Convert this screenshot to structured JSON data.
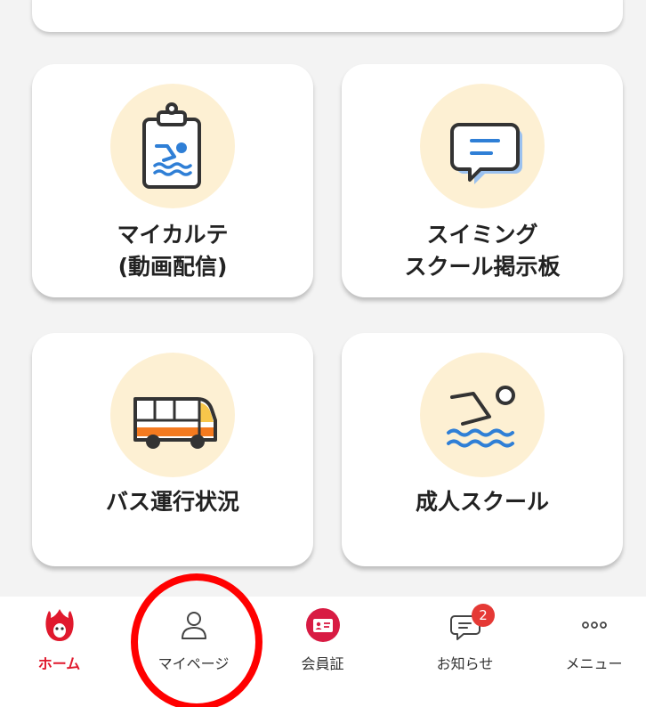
{
  "tiles": [
    {
      "id": "karte",
      "line1": "マイカルテ",
      "line2": "(動画配信)",
      "icon": "clipboard-swimmer-icon"
    },
    {
      "id": "board",
      "line1": "スイミング",
      "line2": "スクール掲示板",
      "icon": "chat-bubble-icon"
    },
    {
      "id": "bus",
      "line1": "バス運行状況",
      "icon": "bus-icon"
    },
    {
      "id": "adult",
      "line1": "成人スクール",
      "icon": "swimmer-icon"
    }
  ],
  "tabbar": {
    "items": [
      {
        "id": "home",
        "label": "ホーム",
        "icon": "flame-mascot-icon",
        "active": true
      },
      {
        "id": "mypage",
        "label": "マイページ",
        "icon": "person-icon"
      },
      {
        "id": "card",
        "label": "会員証",
        "icon": "member-card-icon"
      },
      {
        "id": "news",
        "label": "お知らせ",
        "icon": "chat-icon",
        "badge": "2"
      },
      {
        "id": "menu",
        "label": "メニュー",
        "icon": "more-dots-icon"
      }
    ]
  },
  "colors": {
    "accent": "#e0192d",
    "icon_circle": "#fdf0d3",
    "swim_blue": "#2f7fd6",
    "bus_orange": "#f47a1f",
    "bus_yellow": "#f7c64b",
    "highlight": "#ff0000"
  }
}
